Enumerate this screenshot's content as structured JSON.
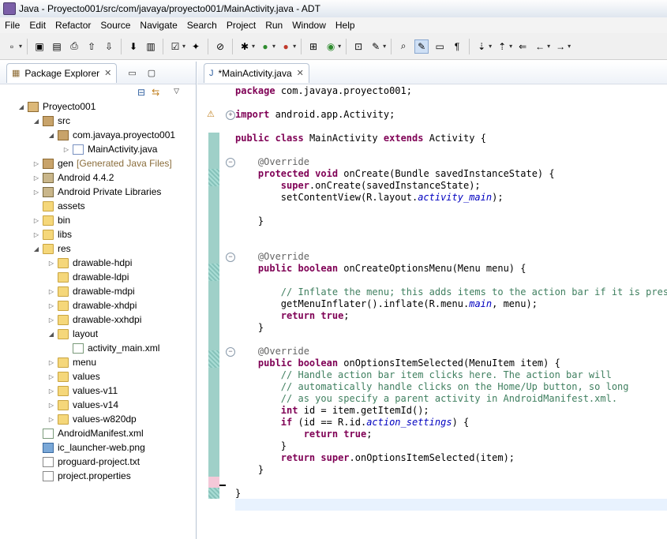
{
  "window": {
    "title": "Java - Proyecto001/src/com/javaya/proyecto001/MainActivity.java - ADT"
  },
  "menu": [
    "File",
    "Edit",
    "Refactor",
    "Source",
    "Navigate",
    "Search",
    "Project",
    "Run",
    "Window",
    "Help"
  ],
  "explorer": {
    "tab_label": "Package Explorer",
    "tree": [
      {
        "label": "Proyecto001",
        "depth": 0,
        "tw": "expanded",
        "icon": "proj"
      },
      {
        "label": "src",
        "depth": 1,
        "tw": "expanded",
        "icon": "pkg"
      },
      {
        "label": "com.javaya.proyecto001",
        "depth": 2,
        "tw": "expanded",
        "icon": "pkg"
      },
      {
        "label": "MainActivity.java",
        "depth": 3,
        "tw": "collapsed",
        "icon": "jfile"
      },
      {
        "label": "gen",
        "depth": 1,
        "tw": "collapsed",
        "icon": "pkg",
        "extra": "[Generated Java Files]"
      },
      {
        "label": "Android 4.4.2",
        "depth": 1,
        "tw": "collapsed",
        "icon": "lib"
      },
      {
        "label": "Android Private Libraries",
        "depth": 1,
        "tw": "collapsed",
        "icon": "lib"
      },
      {
        "label": "assets",
        "depth": 1,
        "tw": "",
        "icon": "folder"
      },
      {
        "label": "bin",
        "depth": 1,
        "tw": "collapsed",
        "icon": "folder"
      },
      {
        "label": "libs",
        "depth": 1,
        "tw": "collapsed",
        "icon": "folder"
      },
      {
        "label": "res",
        "depth": 1,
        "tw": "expanded",
        "icon": "folder"
      },
      {
        "label": "drawable-hdpi",
        "depth": 2,
        "tw": "collapsed",
        "icon": "folder"
      },
      {
        "label": "drawable-ldpi",
        "depth": 2,
        "tw": "",
        "icon": "folder"
      },
      {
        "label": "drawable-mdpi",
        "depth": 2,
        "tw": "collapsed",
        "icon": "folder"
      },
      {
        "label": "drawable-xhdpi",
        "depth": 2,
        "tw": "collapsed",
        "icon": "folder"
      },
      {
        "label": "drawable-xxhdpi",
        "depth": 2,
        "tw": "collapsed",
        "icon": "folder"
      },
      {
        "label": "layout",
        "depth": 2,
        "tw": "expanded",
        "icon": "folder"
      },
      {
        "label": "activity_main.xml",
        "depth": 3,
        "tw": "",
        "icon": "xfile"
      },
      {
        "label": "menu",
        "depth": 2,
        "tw": "collapsed",
        "icon": "folder"
      },
      {
        "label": "values",
        "depth": 2,
        "tw": "collapsed",
        "icon": "folder"
      },
      {
        "label": "values-v11",
        "depth": 2,
        "tw": "collapsed",
        "icon": "folder"
      },
      {
        "label": "values-v14",
        "depth": 2,
        "tw": "collapsed",
        "icon": "folder"
      },
      {
        "label": "values-w820dp",
        "depth": 2,
        "tw": "collapsed",
        "icon": "folder"
      },
      {
        "label": "AndroidManifest.xml",
        "depth": 1,
        "tw": "",
        "icon": "xfile"
      },
      {
        "label": "ic_launcher-web.png",
        "depth": 1,
        "tw": "",
        "icon": "img"
      },
      {
        "label": "proguard-project.txt",
        "depth": 1,
        "tw": "",
        "icon": "txt"
      },
      {
        "label": "project.properties",
        "depth": 1,
        "tw": "",
        "icon": "txt"
      }
    ]
  },
  "editor": {
    "tab_label": "*MainActivity.java",
    "lines": [
      [
        [
          "kw",
          "package"
        ],
        [
          "",
          "com.javaya.proyecto001;"
        ]
      ],
      [],
      [
        [
          "kw",
          "import"
        ],
        [
          "",
          "android.app.Activity;"
        ]
      ],
      [],
      [
        [
          "kw",
          "public"
        ],
        [
          "",
          ""
        ],
        [
          "kw",
          "class"
        ],
        [
          "",
          "MainActivity"
        ],
        [
          "kw",
          "extends"
        ],
        [
          "",
          "Activity {"
        ]
      ],
      [],
      [
        [
          "an",
          "    @Override"
        ]
      ],
      [
        [
          "kw",
          "    protected"
        ],
        [
          "kw",
          "void"
        ],
        [
          "",
          "onCreate(Bundle savedInstanceState) {"
        ]
      ],
      [
        [
          "kw",
          "        super"
        ],
        [
          "",
          ".onCreate(savedInstanceState);"
        ]
      ],
      [
        [
          "",
          "        setContentView(R.layout."
        ],
        [
          "it",
          "activity_main"
        ],
        [
          "",
          ");"
        ]
      ],
      [],
      [
        [
          "",
          "    }"
        ]
      ],
      [],
      [],
      [
        [
          "an",
          "    @Override"
        ]
      ],
      [
        [
          "kw",
          "    public"
        ],
        [
          "kw",
          "boolean"
        ],
        [
          "",
          "onCreateOptionsMenu(Menu menu) {"
        ]
      ],
      [],
      [
        [
          "cm",
          "        // Inflate the menu; this adds items to the action bar if it is present."
        ]
      ],
      [
        [
          "",
          "        getMenuInflater().inflate(R.menu."
        ],
        [
          "it",
          "main"
        ],
        [
          "",
          ", menu);"
        ]
      ],
      [
        [
          "kw",
          "        return"
        ],
        [
          "kw",
          "true"
        ],
        [
          "",
          ";"
        ]
      ],
      [
        [
          "",
          "    }"
        ]
      ],
      [],
      [
        [
          "an",
          "    @Override"
        ]
      ],
      [
        [
          "kw",
          "    public"
        ],
        [
          "kw",
          "boolean"
        ],
        [
          "",
          "onOptionsItemSelected(MenuItem item) {"
        ]
      ],
      [
        [
          "cm",
          "        // Handle action bar item clicks here. The action bar will"
        ]
      ],
      [
        [
          "cm",
          "        // automatically handle clicks on the Home/Up button, so long"
        ]
      ],
      [
        [
          "cm",
          "        // as you specify a parent activity in AndroidManifest.xml."
        ]
      ],
      [
        [
          "kw",
          "        int"
        ],
        [
          "",
          "id = item.getItemId();"
        ]
      ],
      [
        [
          "kw",
          "        if"
        ],
        [
          "",
          "(id == R.id."
        ],
        [
          "it",
          "action_settings"
        ],
        [
          "",
          ") {"
        ]
      ],
      [
        [
          "kw",
          "            return"
        ],
        [
          "kw",
          "true"
        ],
        [
          "",
          ";"
        ]
      ],
      [
        [
          "",
          "        }"
        ]
      ],
      [
        [
          "kw",
          "        return"
        ],
        [
          "kw",
          "super"
        ],
        [
          "",
          ".onOptionsItemSelected(item);"
        ]
      ],
      [
        [
          "",
          "    }"
        ]
      ],
      [],
      [
        [
          "",
          "}"
        ]
      ]
    ]
  },
  "colors": {
    "keyword": "#7f0055",
    "comment": "#3f7f5f",
    "annotation": "#646464",
    "field": "#0000c0"
  }
}
